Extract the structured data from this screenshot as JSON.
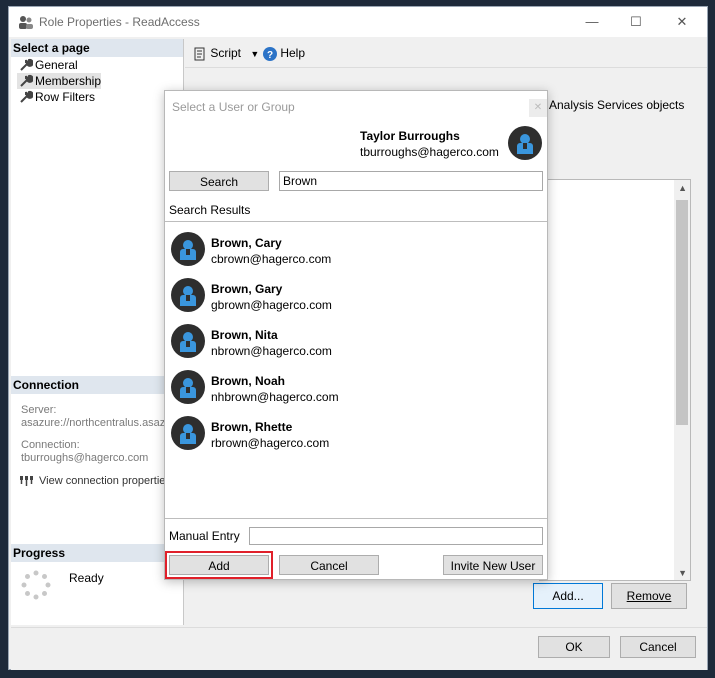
{
  "window": {
    "title": "Role Properties - ReadAccess",
    "minimize": "—",
    "maximize": "☐",
    "close": "✕"
  },
  "left": {
    "select_page": "Select a page",
    "nav": [
      {
        "label": "General"
      },
      {
        "label": "Membership"
      },
      {
        "label": "Row Filters"
      }
    ],
    "connection_head": "Connection",
    "server_label": "Server:",
    "server_value": "asazure://northcentralus.asazu",
    "connection_label": "Connection:",
    "connection_value": "tburroughs@hagerco.com",
    "view_conn": "View connection properties",
    "progress_head": "Progress",
    "progress_status": "Ready"
  },
  "toolbar": {
    "script": "Script",
    "help": "Help"
  },
  "background": {
    "text": "Analysis Services objects",
    "add_label": "Add...",
    "remove_label": "Remove",
    "ok_label": "OK",
    "cancel_label": "Cancel"
  },
  "dialog": {
    "title": "Select a User or Group",
    "close": "✕",
    "current_user": {
      "name": "Taylor Burroughs",
      "email": "tburroughs@hagerco.com"
    },
    "search_label": "Search",
    "search_value": "Brown",
    "results_label": "Search Results",
    "results": [
      {
        "name": "Brown, Cary",
        "email": "cbrown@hagerco.com"
      },
      {
        "name": "Brown, Gary",
        "email": "gbrown@hagerco.com"
      },
      {
        "name": "Brown, Nita",
        "email": "nbrown@hagerco.com"
      },
      {
        "name": "Brown, Noah",
        "email": "nhbrown@hagerco.com"
      },
      {
        "name": "Brown, Rhette",
        "email": "rbrown@hagerco.com"
      }
    ],
    "manual_entry_label": "Manual Entry",
    "manual_entry_value": "",
    "add_label": "Add",
    "cancel_label": "Cancel",
    "invite_label": "Invite New User"
  },
  "colors": {
    "accent": "#3a96dd",
    "highlight": "#e0202a",
    "avatar_bg": "#2e2e2e",
    "section_head": "#dfe6ee"
  }
}
